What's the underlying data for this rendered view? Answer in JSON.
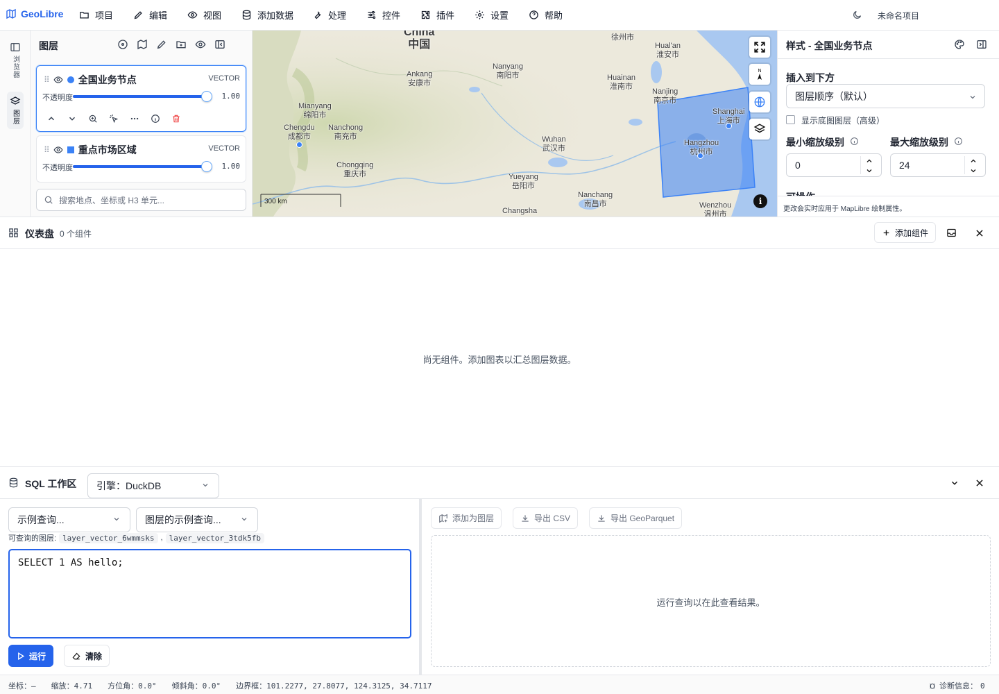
{
  "app": {
    "name": "GeoLibre",
    "project_name": "未命名项目"
  },
  "menu": [
    {
      "label": "项目",
      "icon": "folder-icon"
    },
    {
      "label": "编辑",
      "icon": "pencil-icon"
    },
    {
      "label": "视图",
      "icon": "eye-icon"
    },
    {
      "label": "添加数据",
      "icon": "database-icon"
    },
    {
      "label": "处理",
      "icon": "wrench-icon"
    },
    {
      "label": "控件",
      "icon": "sliders-icon"
    },
    {
      "label": "插件",
      "icon": "puzzle-icon"
    },
    {
      "label": "设置",
      "icon": "gear-icon"
    },
    {
      "label": "帮助",
      "icon": "help-icon"
    }
  ],
  "rail": [
    {
      "label": "浏览器",
      "icon": "browser-panel-icon"
    },
    {
      "label": "图层",
      "icon": "layers-icon",
      "active": true
    }
  ],
  "layers_panel": {
    "title": "图层",
    "opacity_label": "不透明度",
    "layers": [
      {
        "name": "全国业务节点",
        "type": "VECTOR",
        "opacity": "1.00",
        "opacity_fraction": 1.0,
        "color": "#3b82f6",
        "shape": "circle",
        "selected": true
      },
      {
        "name": "重点市场区域",
        "type": "VECTOR",
        "opacity": "1.00",
        "opacity_fraction": 1.0,
        "color": "#3b82f6",
        "shape": "square",
        "selected": false
      }
    ],
    "search_placeholder": "搜索地点、坐标或 H3 单元..."
  },
  "map": {
    "scale_label": "300 km",
    "cities": [
      {
        "en": "China",
        "zh": "中国"
      },
      {
        "en": "Ankang",
        "zh": "安康市"
      },
      {
        "en": "Nanyang",
        "zh": "南阳市"
      },
      {
        "en": "",
        "zh": "徐州市"
      },
      {
        "en": "Hual'an",
        "zh": "淮安市"
      },
      {
        "en": "Huainan",
        "zh": "淮南市"
      },
      {
        "en": "Nanjing",
        "zh": "南京市"
      },
      {
        "en": "Shanghai",
        "zh": "上海市"
      },
      {
        "en": "Hangzhou",
        "zh": "杭州市"
      },
      {
        "en": "Mianyang",
        "zh": "绵阳市"
      },
      {
        "en": "Chengdu",
        "zh": "成都市"
      },
      {
        "en": "Nanchong",
        "zh": "南充市"
      },
      {
        "en": "Chongqing",
        "zh": "重庆市"
      },
      {
        "en": "Wuhan",
        "zh": "武汉市"
      },
      {
        "en": "Yueyang",
        "zh": "岳阳市"
      },
      {
        "en": "Nanchang",
        "zh": "南昌市"
      },
      {
        "en": "Changsha",
        "zh": ""
      },
      {
        "en": "Wenzhou",
        "zh": "温州市"
      }
    ]
  },
  "style_panel": {
    "title": "样式 - 全国业务节点",
    "insert_label": "插入到下方",
    "insert_value": "图层顺序（默认）",
    "show_basemap_label": "显示底图图层（高级）",
    "min_zoom_label": "最小缩放级别",
    "min_zoom_value": "0",
    "max_zoom_label": "最大缩放级别",
    "max_zoom_value": "24",
    "partial_label": "可操作",
    "footer_note": "更改会实时应用于 MapLibre 绘制属性。"
  },
  "dashboard": {
    "title": "仪表盘",
    "count": "0 个组件",
    "add_label": "添加组件",
    "empty_text": "尚无组件。添加图表以汇总图层数据。"
  },
  "sql": {
    "title": "SQL 工作区",
    "engine": "引擎：DuckDB",
    "example_query": "示例查询...",
    "layer_example_query": "图层的示例查询...",
    "queryable_label": "可查询的图层:",
    "queryable_layers": [
      "layer_vector_6wmmsks",
      "layer_vector_3tdk5fb"
    ],
    "query_text": "SELECT 1 AS hello;",
    "run_label": "运行",
    "clear_label": "清除",
    "add_as_layer": "添加为图层",
    "export_csv": "导出 CSV",
    "export_geoparquet": "导出 GeoParquet",
    "results_placeholder": "运行查询以在此查看结果。"
  },
  "status": {
    "coord_label": "坐标：",
    "coord_value": "—",
    "zoom_label": "缩放：",
    "zoom_value": "4.71",
    "bearing_label": "方位角：",
    "bearing_value": "0.0°",
    "pitch_label": "倾斜角：",
    "pitch_value": "0.0°",
    "bounds_label": "边界框：",
    "bounds_value": "101.2277, 27.8077, 124.3125, 34.7117",
    "diag_label": "诊断信息：",
    "diag_value": "0"
  },
  "colors": {
    "accent": "#2563eb",
    "danger": "#ef4444",
    "water": "#a9c8f0",
    "polygon_fill": "#3b82f6"
  }
}
